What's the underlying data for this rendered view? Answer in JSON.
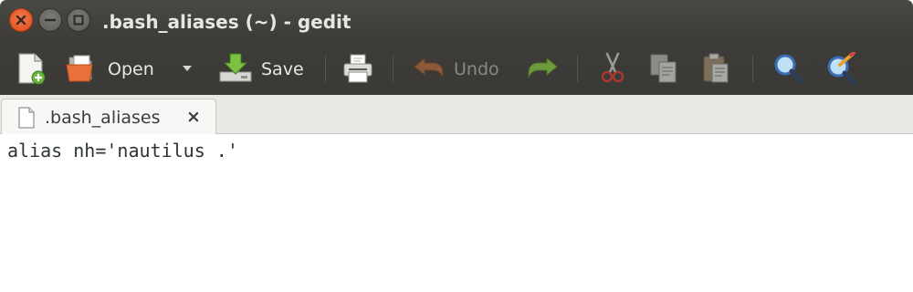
{
  "window": {
    "title": ".bash_aliases (~) - gedit"
  },
  "window_controls": {
    "close": "close-icon",
    "minimize": "minimize-icon",
    "maximize": "maximize-icon"
  },
  "toolbar": {
    "new_icon": "new-document-icon",
    "open_label": "Open",
    "open_dropdown_icon": "dropdown-arrow-icon",
    "save_label": "Save",
    "print_icon": "print-icon",
    "undo_label": "Undo",
    "redo_icon": "redo-icon",
    "cut_icon": "cut-icon",
    "copy_icon": "copy-icon",
    "paste_icon": "paste-icon",
    "find_icon": "find-icon",
    "replace_icon": "find-replace-icon"
  },
  "tabs": [
    {
      "label": ".bash_aliases",
      "close": "×"
    }
  ],
  "editor": {
    "lines": [
      "alias nh='nautilus .'"
    ]
  }
}
